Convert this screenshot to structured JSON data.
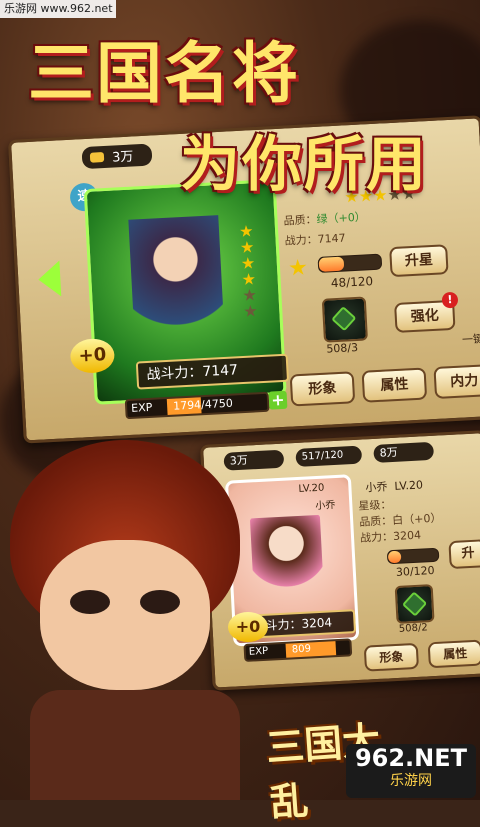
{
  "watermark_top": "乐游网 www.962.net",
  "headline": {
    "line1": "三国名将",
    "line2": "为你所用"
  },
  "panel1": {
    "currency_top": "3万",
    "badge_icon": "speed-badge-icon",
    "quality_label": "品质：",
    "quality_value": "绿（+0）",
    "power_label": "战力：",
    "power_value": "7147",
    "stars_filled": 3,
    "stars_total": 5,
    "level_progress": "48/120",
    "level_progress_fraction": 0.4,
    "upstar_button": "升星",
    "strengthen_button": "强化",
    "alert_badge": "!",
    "item_count": "508/3",
    "card_power_label": "战斗力：",
    "card_power_value": "7147",
    "exp_label": "EXP",
    "exp_value": "1794/4750",
    "exp_fraction": 0.38,
    "plus_badge": "+0",
    "tabs": [
      "形象",
      "属性",
      "内力"
    ],
    "side_label": "一键"
  },
  "panel2": {
    "resource_a": "3万",
    "resource_b": "517/120",
    "resource_c": "8万",
    "level_header": "LV.20",
    "card_name": "小乔",
    "name": "小乔",
    "level": "LV.20",
    "star_label": "星级：",
    "quality_label": "品质：",
    "quality_value": "白（+0）",
    "power_label": "战力：",
    "power_value": "3204",
    "level_progress": "30/120",
    "level_progress_fraction": 0.25,
    "upstar_button": "升",
    "item_count": "508/2",
    "card_power_label": "战斗力：",
    "card_power_value": "3204",
    "exp_label": "EXP",
    "exp_value": "809",
    "plus_badge": "+0",
    "tabs": [
      "形象",
      "属性"
    ]
  },
  "bottom_logo": "三国大乱",
  "brand": {
    "num": "962.NET",
    "sub": "乐游网"
  }
}
